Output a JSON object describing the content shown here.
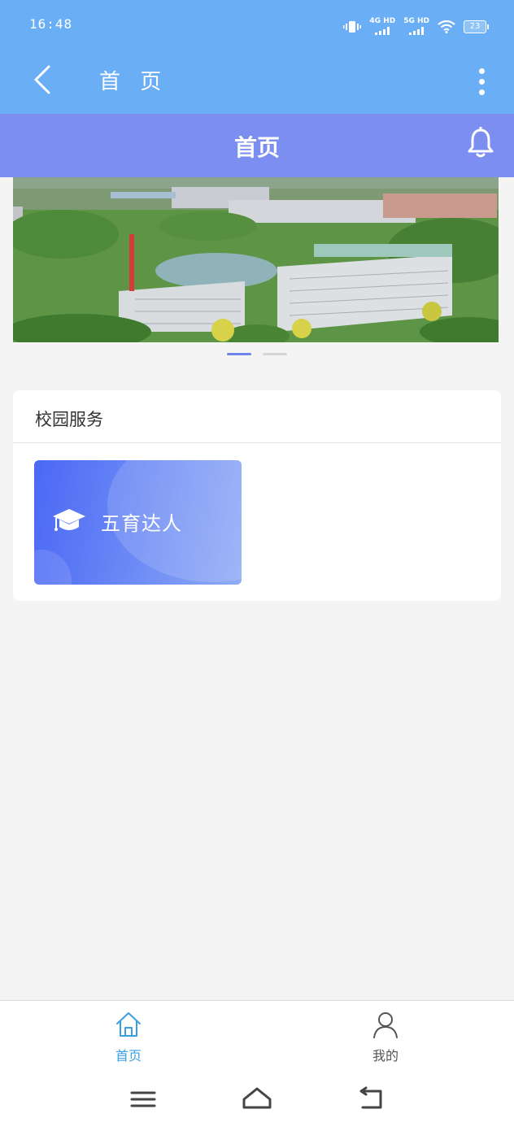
{
  "status_bar": {
    "time": "16:48",
    "signal_1_label": "4G HD",
    "signal_2_label": "5G HD",
    "battery": "23",
    "icons": [
      "vibrate-icon",
      "signal-icon",
      "wifi-icon",
      "battery-icon"
    ]
  },
  "app_bar": {
    "title": "首 页",
    "back_icon": "chevron-left-icon",
    "more_icon": "more-vertical-icon"
  },
  "page_header": {
    "title": "首页",
    "bell_icon": "bell-icon"
  },
  "banner": {
    "image": "campus-aerial-photo",
    "page_count": 2,
    "active_index": 0
  },
  "services": {
    "title": "校园服务",
    "items": [
      {
        "label": "五育达人",
        "icon": "graduation-cap-icon"
      }
    ]
  },
  "tab_bar": {
    "tabs": [
      {
        "label": "首页",
        "icon": "home-icon",
        "active": true
      },
      {
        "label": "我的",
        "icon": "user-icon",
        "active": false
      }
    ]
  },
  "colors": {
    "app_bar": "#6aaef5",
    "page_header": "#7c8ef0",
    "tile_gradient_start": "#4b68f5",
    "tile_gradient_end": "#8faaf6",
    "active_tab": "#3a9fe0"
  }
}
